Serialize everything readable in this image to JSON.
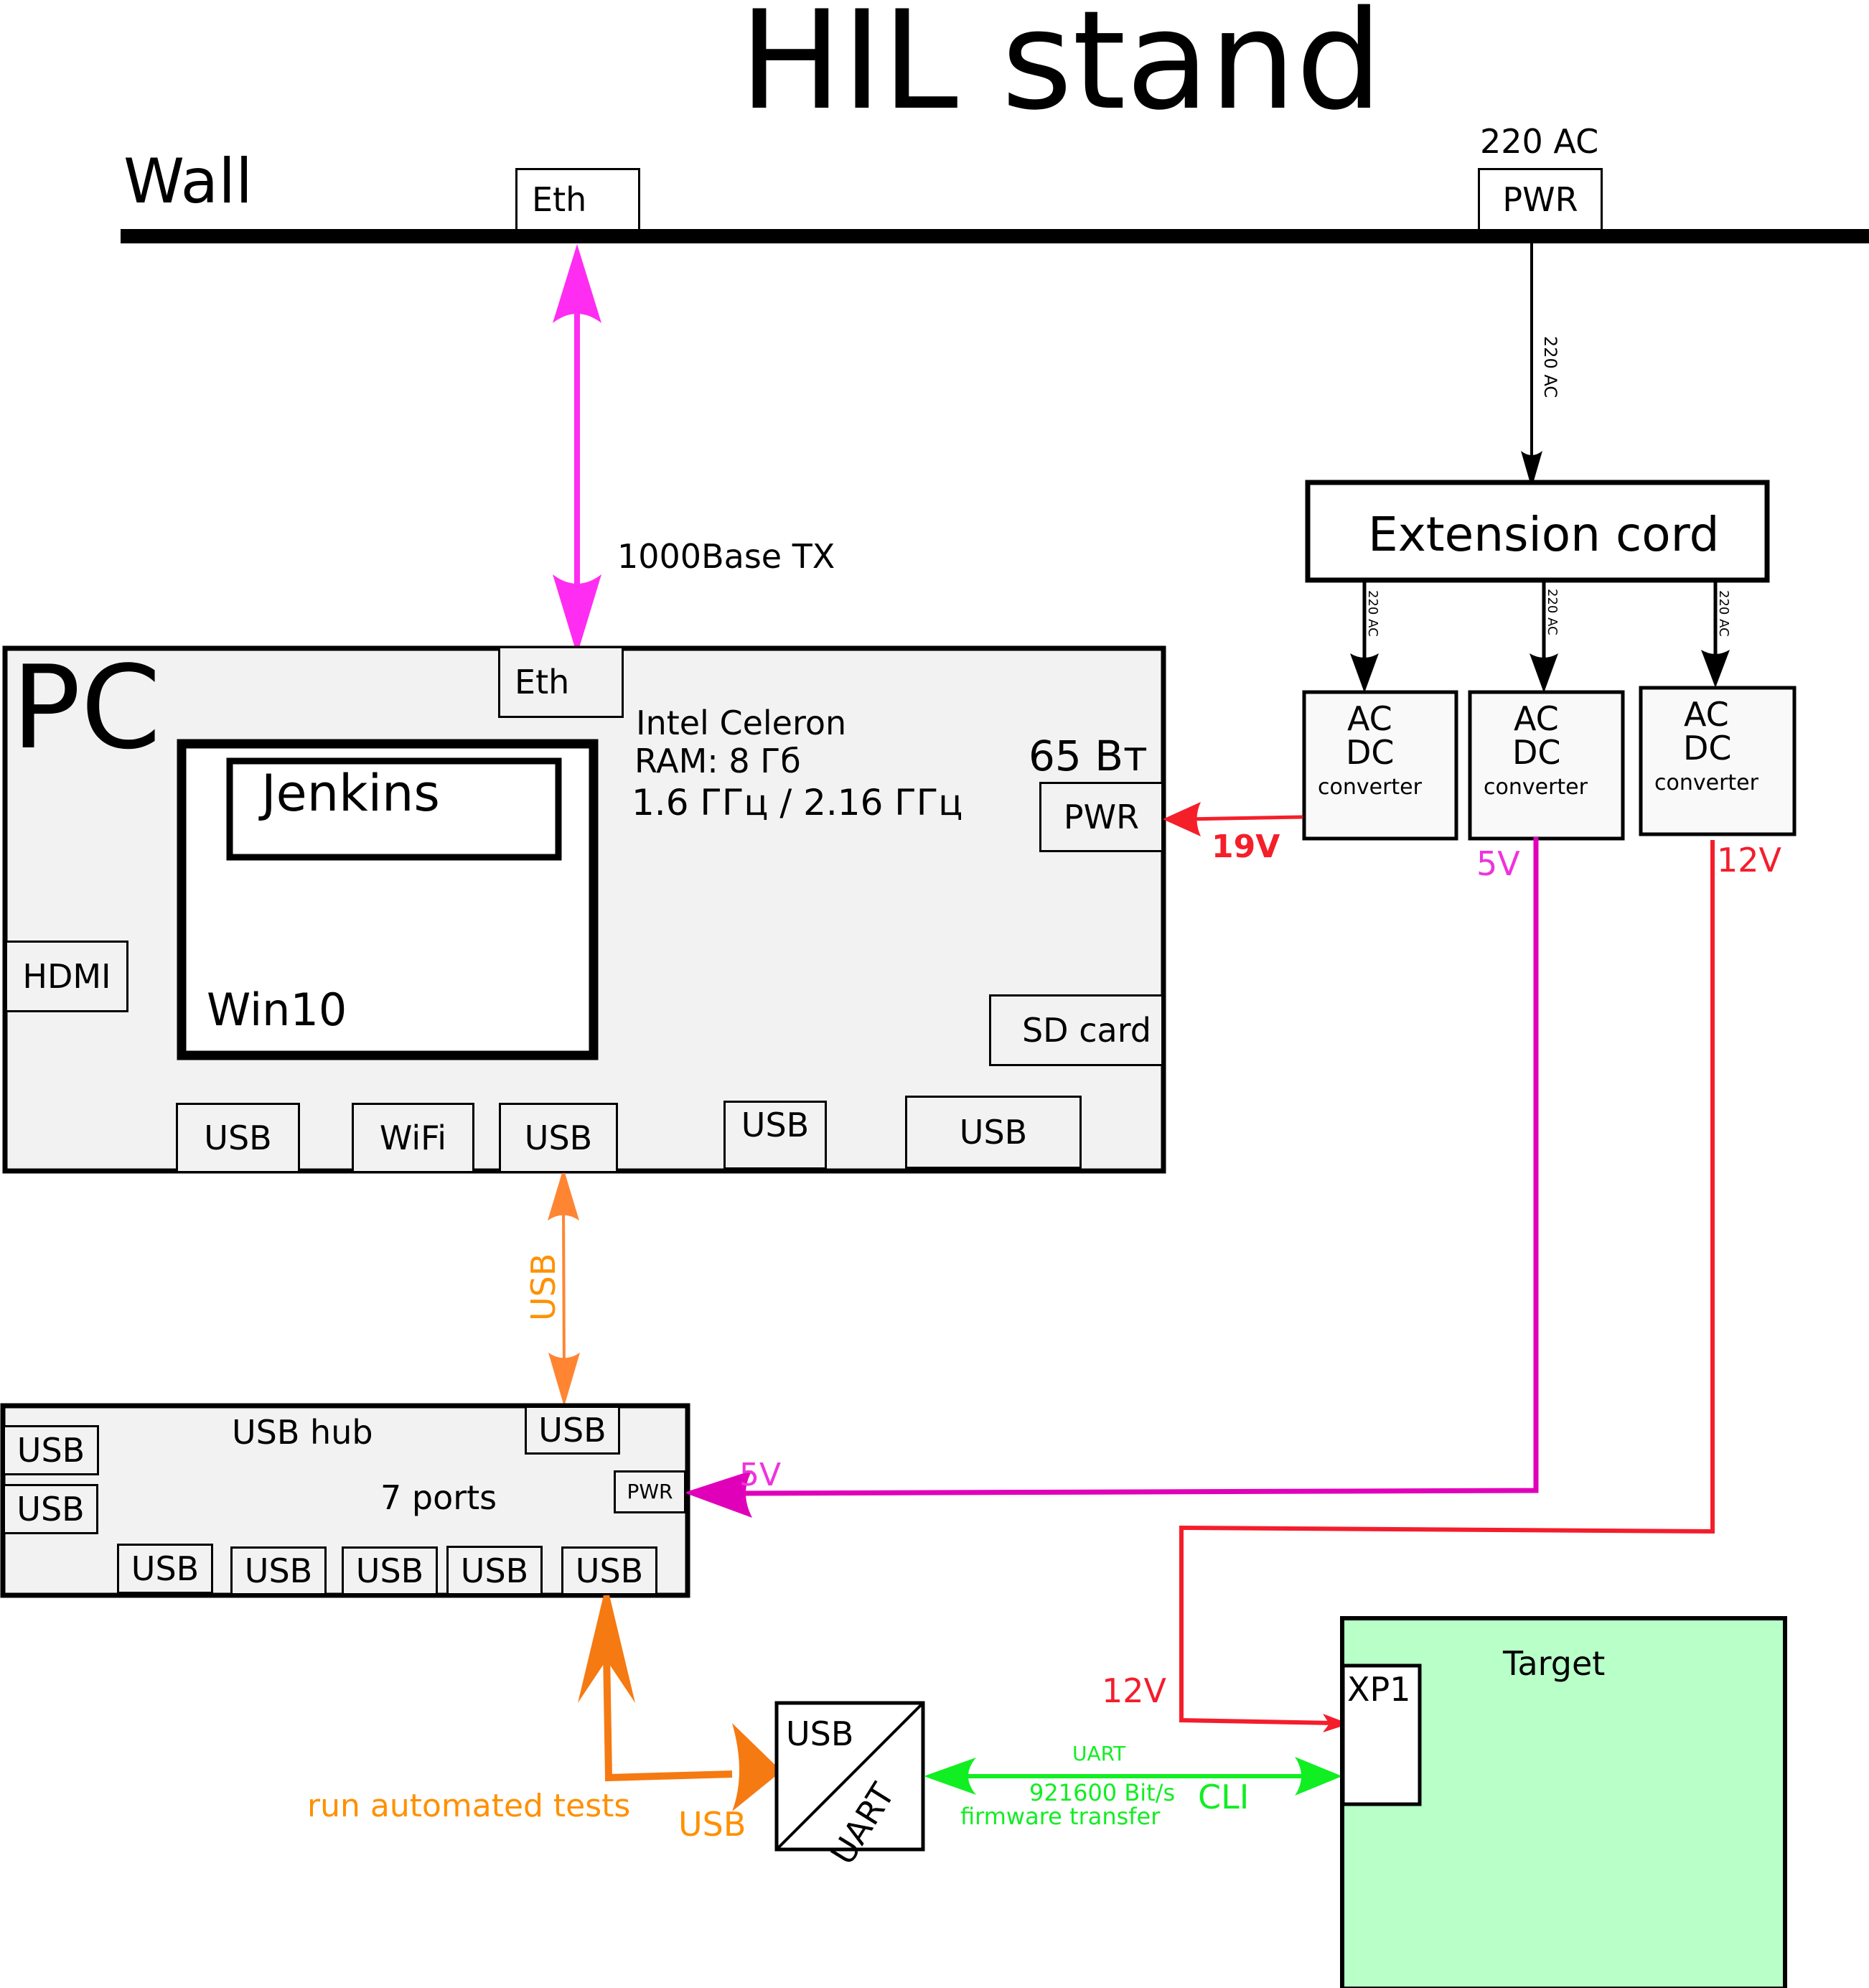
{
  "title": "HIL stand",
  "colors": {
    "ethernet": "#ff2cf2",
    "usb_link": "#ff8533",
    "usb_main": "#f57a12",
    "usb_label": "#ff9000",
    "pwr_19v": "#f51f2a",
    "pwr_5v": "#e000b9",
    "pwr_5v_label": "#ee33dd",
    "pwr_12v": "#f41d2c",
    "uart": "#11ee22",
    "target_fill": "#b8ffc8",
    "box_fill": "#f2f2f2"
  },
  "wall": {
    "label": "Wall",
    "eth_port": "Eth",
    "pwr_port": "PWR",
    "pwr_caption": "220 AC"
  },
  "links": {
    "ethernet": "1000Base TX",
    "wall_to_extension": "220 AC",
    "extension_to_converters": [
      "220 AC",
      "220 AC",
      "220 AC"
    ],
    "pc_to_hub": "USB",
    "hub_to_converter": "USB",
    "hub_to_converter_note": "run automated tests",
    "uart_top": "UART",
    "uart_bottom_1": "921600 Bit/s",
    "uart_bottom_2": "firmware transfer",
    "uart_side": "CLI",
    "v19": "19V",
    "v5_top": "5V",
    "v5_hub": "5V",
    "v12_top": "12V",
    "v12_target": "12V"
  },
  "extension_cord": {
    "label": "Extension cord"
  },
  "converters": [
    {
      "line1": "AC",
      "line2": "DC",
      "line3": "converter",
      "output": "19V"
    },
    {
      "line1": "AC",
      "line2": "DC",
      "line3": "converter",
      "output": "5V"
    },
    {
      "line1": "AC",
      "line2": "DC",
      "line3": "converter",
      "output": "12V"
    }
  ],
  "pc": {
    "label": "PC",
    "eth_port": "Eth",
    "spec_cpu": "Intel Celeron",
    "spec_ram": "RAM: 8 Гб",
    "spec_freq": "1.6 ГГц / 2.16 ГГц",
    "power_rating": "65 Вт",
    "pwr_port": "PWR",
    "hdmi_port": "HDMI",
    "sd_port": "SD card",
    "os_label": "Win10",
    "app_label": "Jenkins",
    "bottom_ports": [
      "USB",
      "WiFi",
      "USB",
      "USB",
      "USB"
    ]
  },
  "usb_hub": {
    "label": "USB hub",
    "ports_caption": "7 ports",
    "upstream_port": "USB",
    "pwr_port": "PWR",
    "left_ports": [
      "USB",
      "USB"
    ],
    "bottom_ports": [
      "USB",
      "USB",
      "USB",
      "USB",
      "USB"
    ]
  },
  "usb_uart_converter": {
    "top": "USB",
    "bottom": "UART"
  },
  "target": {
    "label": "Target",
    "connector": "XP1"
  }
}
